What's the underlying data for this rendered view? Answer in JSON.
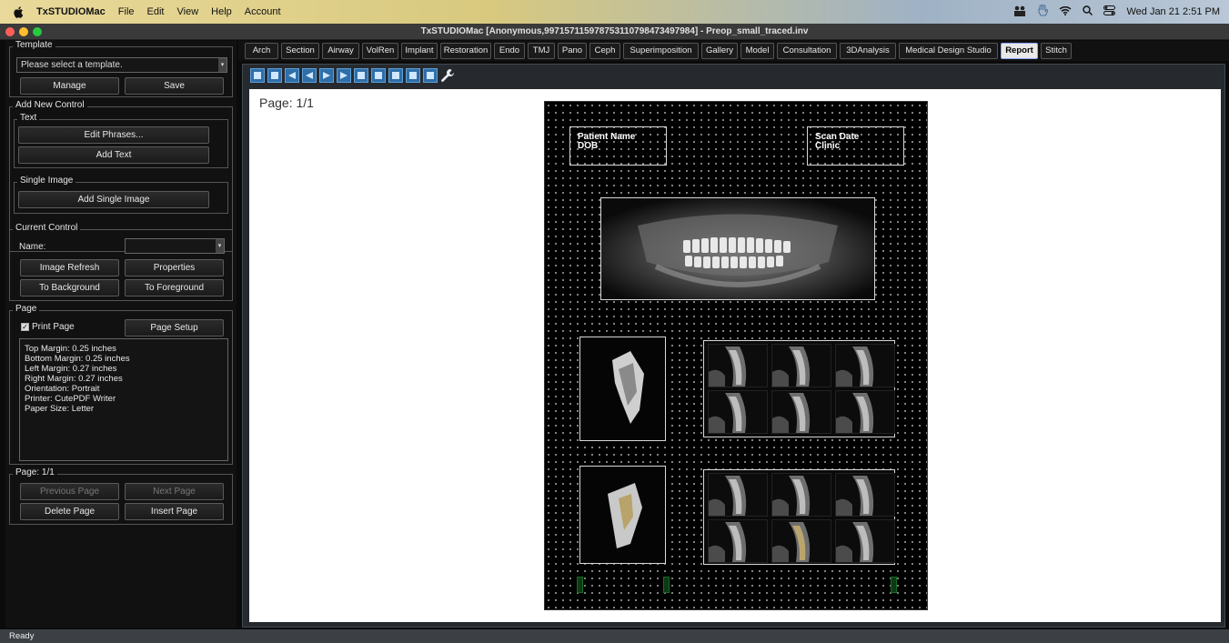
{
  "menubar": {
    "app_name": "TxSTUDIOMac",
    "menus": [
      "File",
      "Edit",
      "View",
      "Help",
      "Account"
    ],
    "clock": "Wed Jan 21  2:51 PM"
  },
  "window": {
    "title": "TxSTUDIOMac [Anonymous,9971571159787531107984734979​84] - Preop_small_traced.inv"
  },
  "template": {
    "legend": "Template",
    "select_value": "Please select a template.",
    "manage_label": "Manage",
    "save_label": "Save"
  },
  "add_new_control": {
    "legend": "Add New Control",
    "text_legend": "Text",
    "edit_phrases_label": "Edit Phrases...",
    "add_text_label": "Add Text",
    "single_image_legend": "Single Image",
    "add_single_image_label": "Add Single Image"
  },
  "current_control": {
    "legend": "Current Control",
    "name_label": "Name:",
    "name_value": "",
    "image_refresh_label": "Image Refresh",
    "properties_label": "Properties",
    "to_background_label": "To Background",
    "to_foreground_label": "To Foreground"
  },
  "page": {
    "legend": "Page",
    "print_page_label": "Print Page",
    "print_page_checked": true,
    "page_setup_label": "Page Setup",
    "info_lines": [
      "Top Margin: 0.25 inches",
      "Bottom Margin: 0.25 inches",
      "Left Margin: 0.27 inches",
      "Right Margin: 0.27 inches",
      "Orientation: Portrait",
      "Printer: CutePDF Writer",
      "Paper Size: Letter"
    ]
  },
  "page_nav": {
    "legend": "Page: 1/1",
    "previous_label": "Previous Page",
    "next_label": "Next Page",
    "delete_label": "Delete Page",
    "insert_label": "Insert Page"
  },
  "tabs": [
    {
      "label": "Arch",
      "active": false
    },
    {
      "label": "Section",
      "active": false
    },
    {
      "label": "Airway",
      "active": false
    },
    {
      "label": "VolRen",
      "active": false
    },
    {
      "label": "Implant",
      "active": false
    },
    {
      "label": "Restoration",
      "active": false
    },
    {
      "label": "Endo",
      "active": false
    },
    {
      "label": "TMJ",
      "active": false
    },
    {
      "label": "Pano",
      "active": false
    },
    {
      "label": "Ceph",
      "active": false
    },
    {
      "label": "Superimposition",
      "active": false
    },
    {
      "label": "Gallery",
      "active": false
    },
    {
      "label": "Model",
      "active": false
    },
    {
      "label": "Consultation",
      "active": false
    },
    {
      "label": "3DAnalysis",
      "active": false
    },
    {
      "label": "Medical Design Studio",
      "active": false
    },
    {
      "label": "Report",
      "active": true
    },
    {
      "label": "Stitch",
      "active": false
    }
  ],
  "toolbar_icons": [
    "add-page-icon",
    "insert-page-icon",
    "first-page-icon",
    "previous-page-icon",
    "next-page-icon",
    "last-page-icon",
    "add-image-icon",
    "add-image-alt-icon",
    "remove-image-icon",
    "export-icon",
    "save-report-icon",
    "settings-wrench-icon"
  ],
  "canvas": {
    "page_label": "Page: 1/1",
    "report": {
      "patient_name_label": "Patient Name",
      "dob_label": "DOB",
      "scan_date_label": "Scan Date",
      "clinic_label": "Clinic"
    }
  },
  "status": {
    "text": "Ready"
  },
  "colors": {
    "accent": "#2f6ea8",
    "active_tab_border": "#8aa6ff",
    "traffic_red": "#ff5f57",
    "traffic_yellow": "#febc2e",
    "traffic_green": "#28c840"
  }
}
